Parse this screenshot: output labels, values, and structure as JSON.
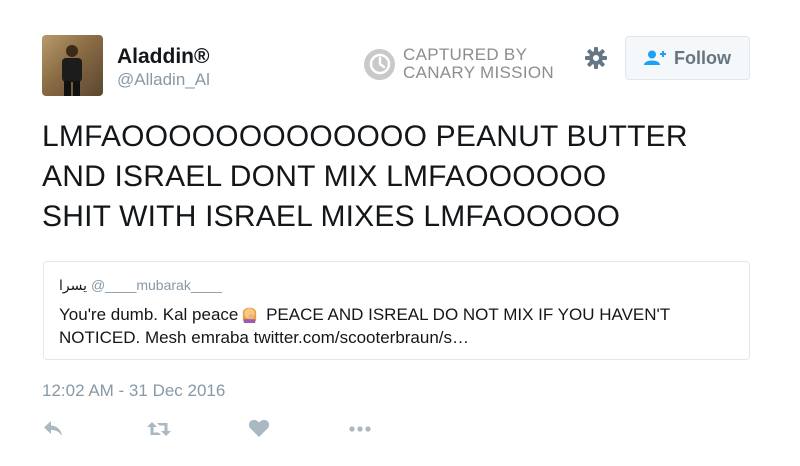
{
  "author": {
    "name": "Aladdin®",
    "handle": "@Alladin_Al",
    "avatar_icon": "user-avatar"
  },
  "capture_badge": {
    "line1": "CAPTURED BY",
    "line2": "CANARY MISSION",
    "icon": "clock-icon"
  },
  "settings_icon": "gear-icon",
  "follow_button": {
    "label": "Follow",
    "icon": "add-user-icon"
  },
  "tweet": {
    "lines": [
      "LMFAOOOOOOOOOOOOO PEANUT BUTTER",
      "AND ISRAEL DONT MIX LMFAOOOOOO",
      "SHIT WITH ISRAEL MIXES LMFAOOOOO"
    ],
    "timestamp": "12:02 AM - 31 Dec 2016"
  },
  "quoted_tweet": {
    "name": "يسرا",
    "handle": "@____mubarak____",
    "text_before_emoji": "You're dumb. Kal peace",
    "emoji": "woman-facepalming-emoji",
    "text_after_emoji": " PEACE AND ISREAL DO NOT MIX IF YOU HAVEN'T NOTICED. Mesh emraba twitter.com/scooterbraun/s…"
  },
  "actions": [
    {
      "icon": "reply-icon"
    },
    {
      "icon": "retweet-icon"
    },
    {
      "icon": "like-icon"
    },
    {
      "icon": "more-icon"
    }
  ],
  "colors": {
    "text": "#14171a",
    "muted": "#8899a6",
    "border": "#e1e8ed",
    "badge_gray": "#8d8d8d",
    "action_gray": "#aab8c2"
  }
}
